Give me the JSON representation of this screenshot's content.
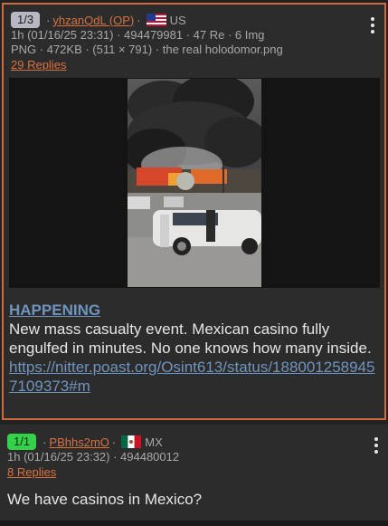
{
  "posts": [
    {
      "index": "1/3",
      "username": "yhzanQdL (OP)",
      "country": "US",
      "meta_line": "1h (01/16/25 23:31) · 494479981 · 47 Re · 6 Img",
      "file_line": "PNG · 472KB · (511 × 791) · the real holodomor.png",
      "replies": "29 Replies",
      "headline": "HAPPENING",
      "text": "New mass casualty event. Mexican casino fully engulfed in minutes. No one knows how many inside.",
      "link": "https://nitter.poast.org/Osint613/status/1880012589457109373#m"
    },
    {
      "index": "1/1",
      "username": "PBhhs2mO",
      "country": "MX",
      "meta_line": "1h (01/16/25 23:32) · 494480012",
      "replies": "8 Replies",
      "text": "We have casinos in Mexico?"
    }
  ],
  "colors": {
    "background": "#222222",
    "post_bg": "#2c2c2c",
    "op_border": "#d26a3d",
    "username": "#d9713f",
    "link": "#6f95bf",
    "index_badge_op": "#b8b8c4",
    "index_badge_reply": "#33d24a"
  },
  "icons": [
    "us-flag-icon",
    "mx-flag-icon",
    "more-vert-icon"
  ]
}
